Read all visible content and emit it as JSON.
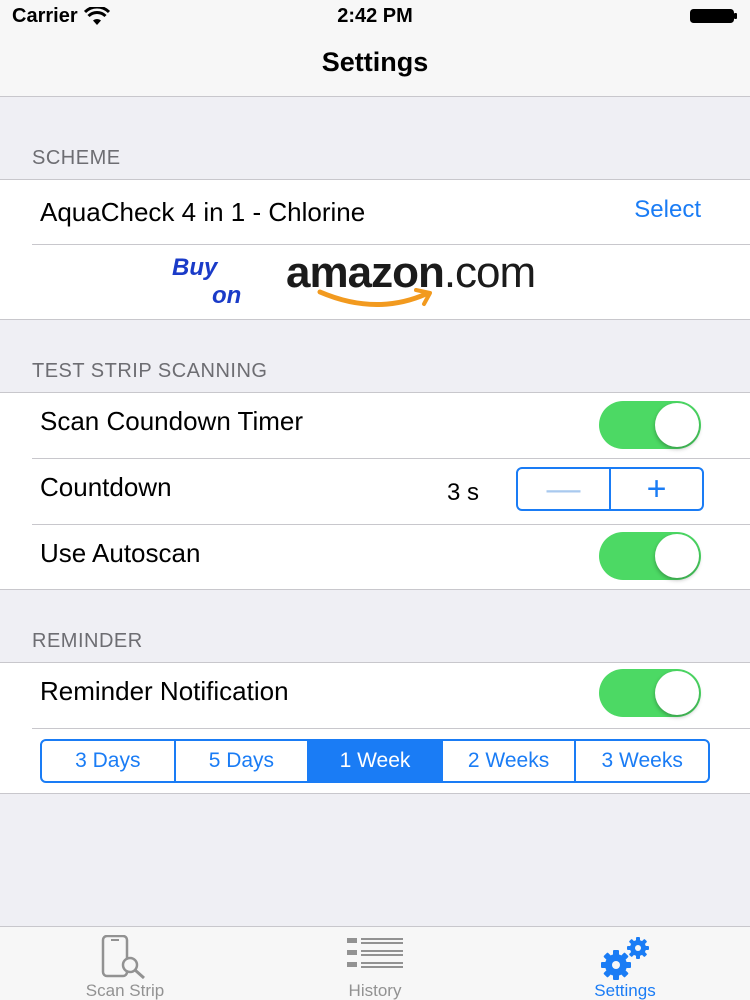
{
  "status_bar": {
    "carrier": "Carrier",
    "time": "2:42 PM"
  },
  "nav": {
    "title": "Settings"
  },
  "scheme": {
    "header": "SCHEME",
    "scheme_name": "AquaCheck 4 in 1 - Chlorine",
    "select_label": "Select",
    "amazon_banner": {
      "buy": "Buy",
      "on": "on",
      "brand": "amazon",
      "tld": ".com"
    }
  },
  "test_strip": {
    "header": "TEST STRIP SCANNING",
    "countdown_timer_label": "Scan Coundown Timer",
    "countdown_timer_on": true,
    "countdown_label": "Countdown",
    "countdown_value": "3 s",
    "stepper_minus": "—",
    "stepper_plus": "+",
    "autoscan_label": "Use Autoscan",
    "autoscan_on": true
  },
  "reminder": {
    "header": "REMINDER",
    "notification_label": "Reminder Notification",
    "notification_on": true,
    "intervals": [
      "3 Days",
      "5 Days",
      "1 Week",
      "2 Weeks",
      "3 Weeks"
    ],
    "selected_interval": "1 Week"
  },
  "tabbar": {
    "tabs": [
      {
        "label": "Scan Strip",
        "icon": "phone-magnifier-icon",
        "active": false
      },
      {
        "label": "History",
        "icon": "list-icon",
        "active": false
      },
      {
        "label": "Settings",
        "icon": "gears-icon",
        "active": true
      }
    ]
  },
  "colors": {
    "accent": "#1a7cf5",
    "toggle_on": "#4cd964",
    "background": "#efeff4"
  }
}
